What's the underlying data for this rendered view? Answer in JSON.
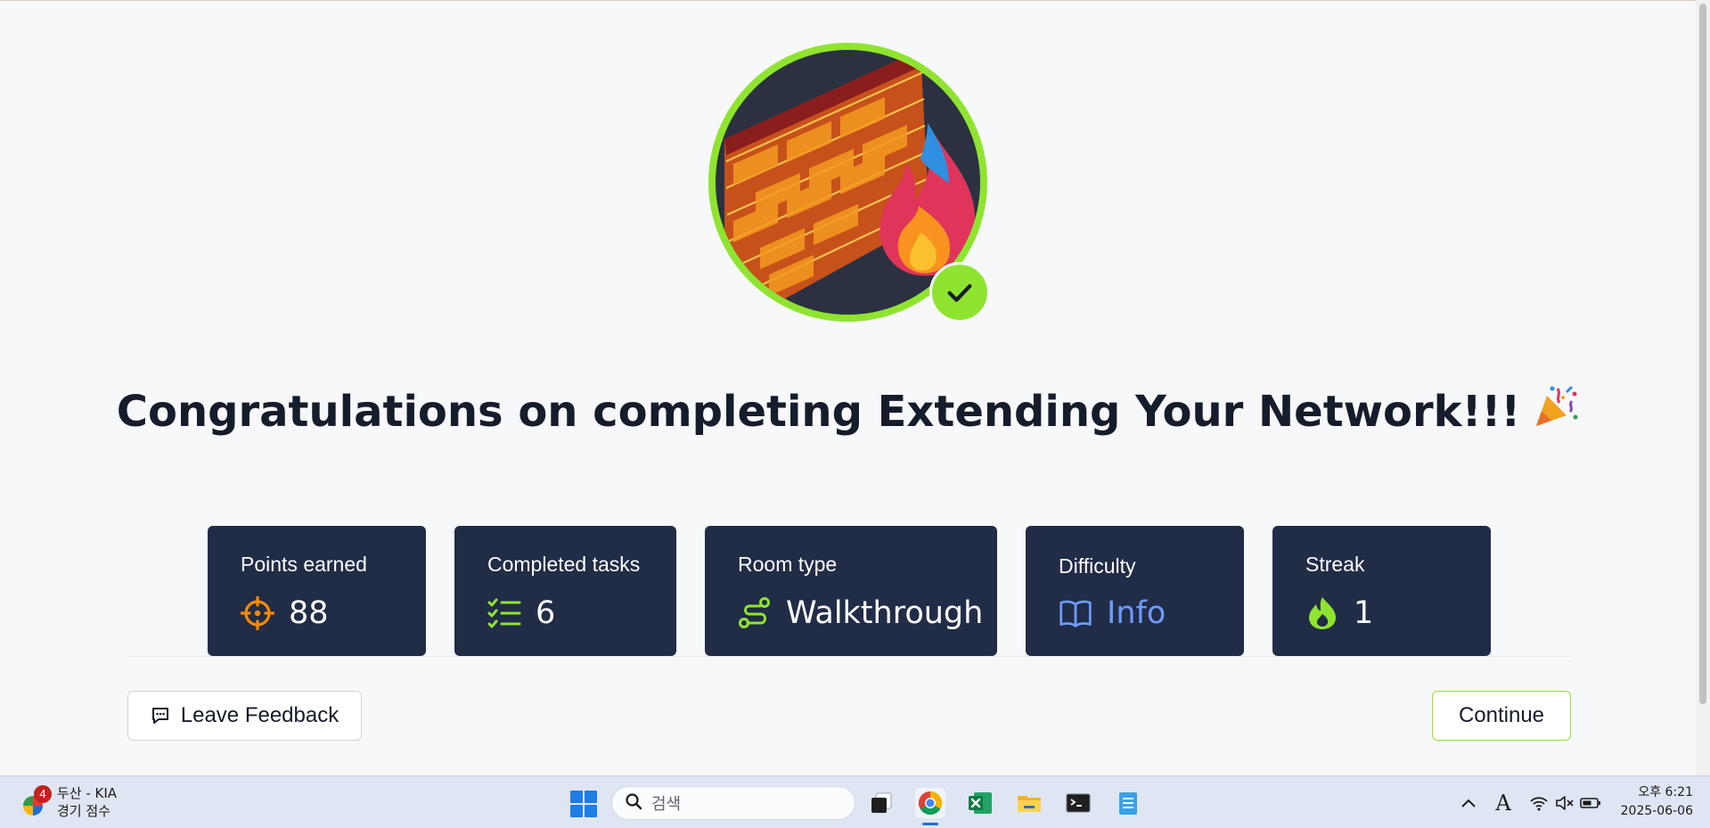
{
  "page": {
    "headline": "Congratulations on completing Extending Your Network!!!",
    "headline_emoji": "🎉"
  },
  "stats": [
    {
      "label": "Points earned",
      "value": "88",
      "icon": "crosshair-icon",
      "icon_color": "#f58a07"
    },
    {
      "label": "Completed tasks",
      "value": "6",
      "icon": "checklist-icon",
      "icon_color": "#8fe430"
    },
    {
      "label": "Room type",
      "value": "Walkthrough",
      "icon": "route-icon",
      "icon_color": "#8fe430"
    },
    {
      "label": "Difficulty",
      "value": "Info",
      "icon": "book-icon",
      "icon_color": "#6d9bff"
    },
    {
      "label": "Streak",
      "value": "1",
      "icon": "flame-icon",
      "icon_color": "#8fe430"
    }
  ],
  "actions": {
    "feedback_label": "Leave Feedback",
    "continue_label": "Continue"
  },
  "colors": {
    "accent": "#8fe430",
    "card_bg": "#212c47",
    "page_bg": "#f7f8fa",
    "info": "#6d9bff"
  },
  "taskbar": {
    "notice_count": "4",
    "notice_line1": "두산 - KIA",
    "notice_line2": "경기 점수",
    "search_placeholder": "검색",
    "clock_time": "오후 6:21",
    "clock_date": "2025-06-06",
    "ime_label": "A"
  }
}
